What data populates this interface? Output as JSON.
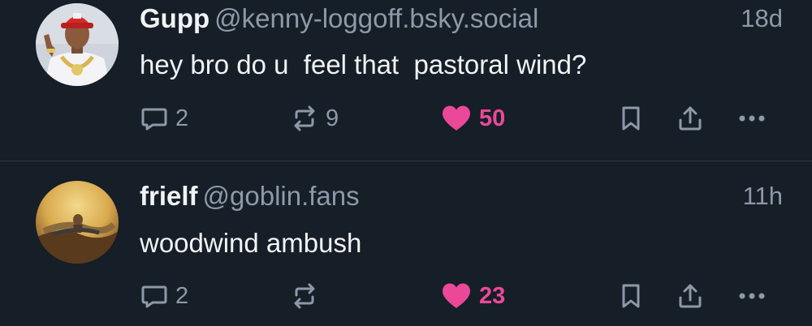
{
  "colors": {
    "background": "#161e27",
    "divider": "#2e3b49",
    "primary_text": "#f1f3f5",
    "secondary_text": "#8d99a8",
    "like_active": "#ec4899"
  },
  "posts": [
    {
      "display_name": "Gupp",
      "handle": "@kenny-loggoff.bsky.social",
      "timestamp": "18d",
      "text": "hey bro do u  feel that  pastoral wind?",
      "avatar_icon": "avatar-photo-red-cap-figure",
      "actions": {
        "reply_count": "2",
        "repost_count": "9",
        "like_count": "50",
        "liked": true
      }
    },
    {
      "display_name": "frielf",
      "handle": "@goblin.fans",
      "timestamp": "11h",
      "text": "woodwind ambush",
      "avatar_icon": "avatar-painting-figure-in-sky",
      "actions": {
        "reply_count": "2",
        "repost_count": "",
        "like_count": "23",
        "liked": true
      }
    }
  ],
  "icons": {
    "reply": "speech-bubble-icon",
    "repost": "repost-arrows-icon",
    "like": "heart-icon",
    "bookmark": "bookmark-icon",
    "share": "share-upload-icon",
    "more": "ellipsis-icon"
  }
}
